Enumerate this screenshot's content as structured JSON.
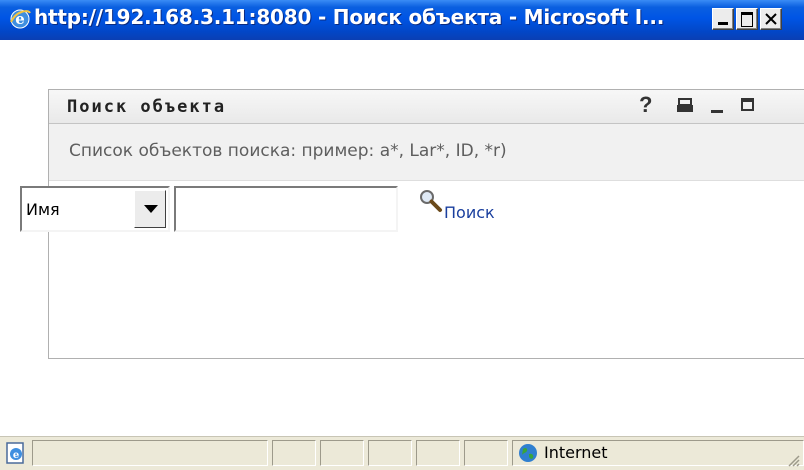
{
  "window": {
    "title": "http://192.168.3.11:8080 - Поиск объекта - Microsoft I..."
  },
  "portlet": {
    "title": "Поиск объекта",
    "help_label": "?",
    "description": "Список объектов поиска: пример: a*, Lar*, ID, *r)"
  },
  "search": {
    "field_select_value": "Имя",
    "query_value": "",
    "search_link_label": "Поиск"
  },
  "statusbar": {
    "zone_label": "Internet"
  },
  "colors": {
    "titlebar": "#0055e5",
    "link": "#1a3f9e",
    "description_bg": "#f1f1f1"
  },
  "icons": [
    "ie-logo-icon",
    "minimize-icon",
    "maximize-icon",
    "close-icon",
    "help-icon",
    "print-icon",
    "portlet-minimize-icon",
    "portlet-maximize-icon",
    "dropdown-arrow-icon",
    "magnifier-icon",
    "page-icon",
    "globe-icon",
    "resize-grip-icon"
  ]
}
